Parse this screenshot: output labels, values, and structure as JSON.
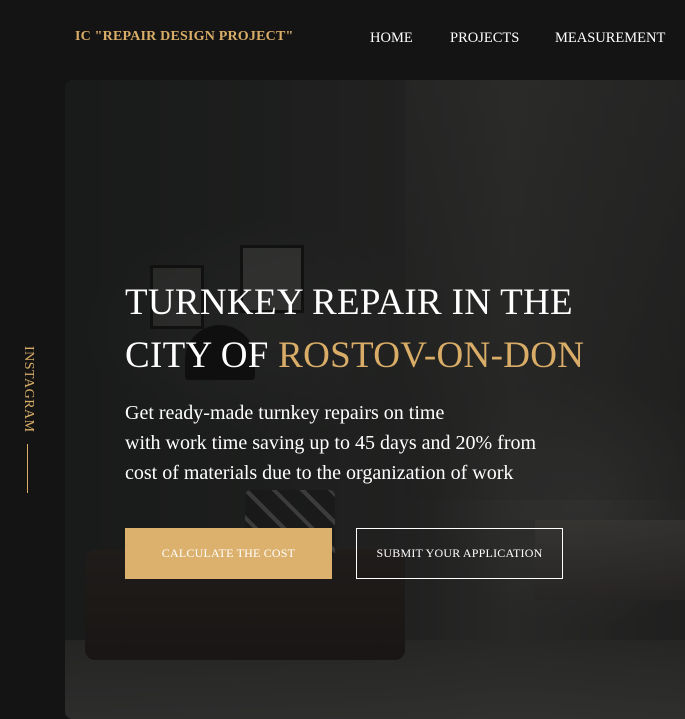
{
  "header": {
    "logo": "IC \"REPAIR DESIGN PROJECT\"",
    "nav": [
      {
        "label": "HOME"
      },
      {
        "label": "PROJECTS"
      },
      {
        "label": "MEASUREMENT"
      }
    ]
  },
  "side": {
    "instagram_label": "INSTAGRAM"
  },
  "hero": {
    "title_part1": "TURNKEY REPAIR IN THE",
    "title_part2": "CITY OF ",
    "title_accent": "ROSTOV-ON-DON",
    "description_lines": [
      "Get ready-made turnkey repairs on time",
      "with work time saving up to 45 days and 20% from",
      "cost of materials due to the organization of work"
    ],
    "primary_button": "CALCULATE THE COST",
    "secondary_button": "SUBMIT YOUR APPLICATION"
  },
  "colors": {
    "accent": "#d9ad67",
    "button_fill": "#dcb16d",
    "background": "#141414",
    "text": "#ffffff"
  }
}
